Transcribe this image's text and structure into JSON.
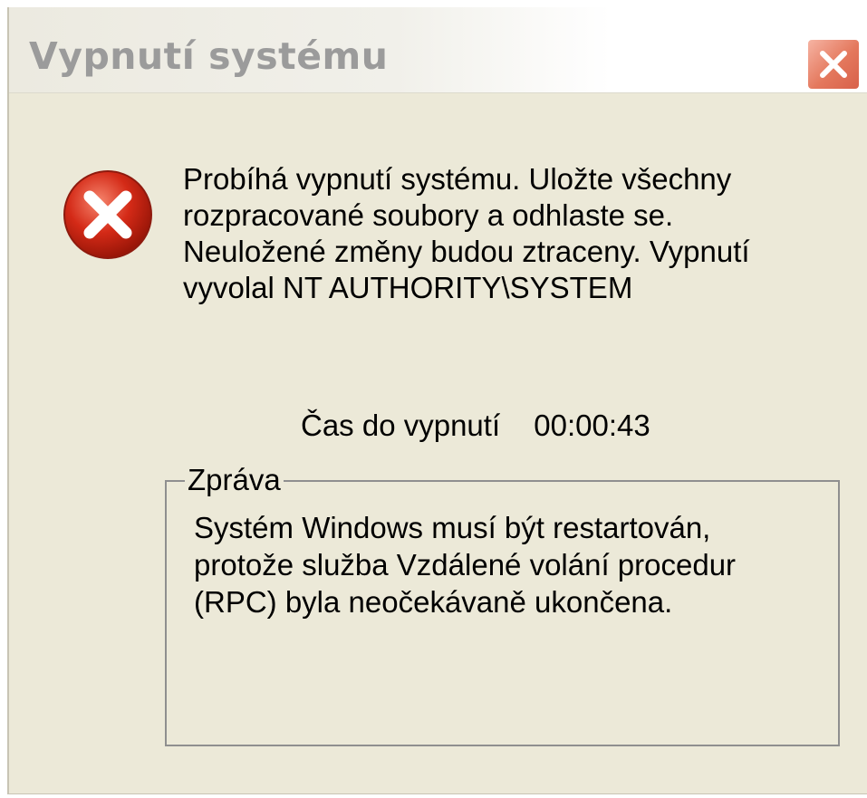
{
  "window": {
    "title": "Vypnutí systému",
    "close_icon": "close-icon"
  },
  "icon": {
    "name": "error-icon",
    "color": "#d42a17"
  },
  "message": {
    "lines": [
      "Probíhá vypnutí systému. Uložte všechny",
      "rozpracované soubory a odhlaste se.",
      "Neuložené změny budou ztraceny. Vypnutí",
      "vyvolal NT AUTHORITY\\SYSTEM"
    ]
  },
  "countdown": {
    "label": "Čas do vypnutí",
    "time": "00:00:43"
  },
  "groupbox": {
    "label": "Zpráva",
    "lines": [
      "Systém Windows musí být restartován,",
      "protože služba Vzdálené volání procedur",
      "(RPC) byla neočekávaně ukončena."
    ]
  },
  "colors": {
    "dialog_background": "#ece9d8",
    "title_text": "#9b9b9b",
    "close_button": "#e4785d"
  }
}
